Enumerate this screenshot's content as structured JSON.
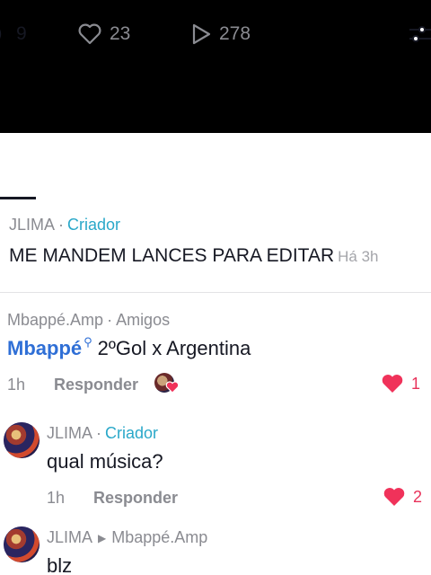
{
  "tabs": {
    "comments": {
      "count": "9"
    },
    "likes": {
      "count": "23"
    },
    "views": {
      "count": "278"
    }
  },
  "creator_post": {
    "author": "JLIMA",
    "separator": "·",
    "role": "Criador",
    "text": "ME MANDEM LANCES PARA EDITAR",
    "time": "Há 3h"
  },
  "comments": [
    {
      "author": "Mbappé.Amp",
      "separator": "·",
      "relation": "Amigos",
      "mention": "Mbappé",
      "text": "2ºGol x Argentina",
      "time": "1h",
      "reply_label": "Responder",
      "likes": "1"
    },
    {
      "author": "JLIMA",
      "separator": "·",
      "role": "Criador",
      "text": "qual música?",
      "time": "1h",
      "reply_label": "Responder",
      "likes": "2"
    },
    {
      "author": "JLIMA",
      "reply_to": "Mbappé.Amp",
      "text": "blz"
    }
  ],
  "colors": {
    "accent_creator": "#2aa8c9",
    "mention": "#2f6fd6",
    "like": "#f0325a"
  }
}
